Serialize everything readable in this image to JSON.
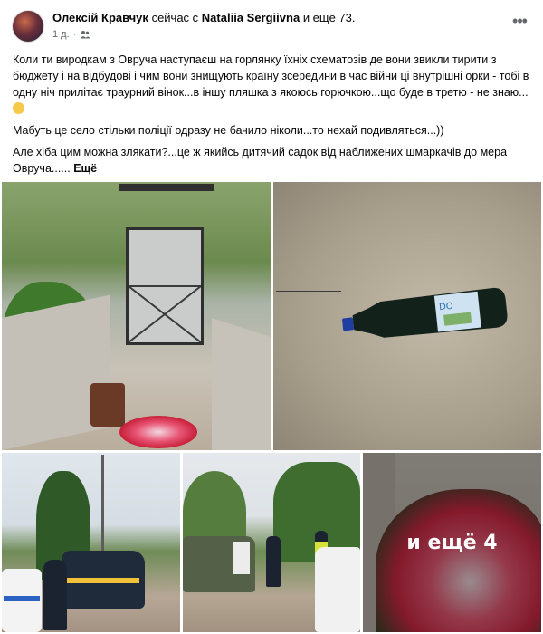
{
  "post": {
    "author": "Олексій Кравчук",
    "with_text": "сейчас с",
    "tagged": "Nataliia Sergiivna",
    "others": "и ещё 73.",
    "time": "1 д.",
    "audience_icon": "friends-icon",
    "menu_icon": "more-options-icon"
  },
  "text": {
    "p1": "Коли ти виродкам з Овруча наступаєш на горлянку їхніх схематозів де вони звикли тирити з бюджету і на відбудові і чим вони знищують країну зсередини в час війни ці внутрішні орки - тобі в одну ніч прилітає траурний вінок...в іншу пляшка з якоюсь горючкою...що буде в третю - не знаю...",
    "p2": "Мабуть це село стільки поліції одразу не бачило ніколи...то нехай подивляться...))",
    "p3": "Але хіба цим можна злякати?...це ж якийсь дитячий садок від наближених шмаркачів до мера Овруча......",
    "more": "Ещё"
  },
  "photos": {
    "overlay_label": "и ещё 4",
    "items": [
      "gate-with-wreath",
      "bottle-on-ground",
      "police-cars-street",
      "pickup-and-police",
      "funeral-wreath"
    ]
  },
  "colors": {
    "text": "#050505",
    "secondary": "#65676b",
    "background": "#ffffff"
  }
}
